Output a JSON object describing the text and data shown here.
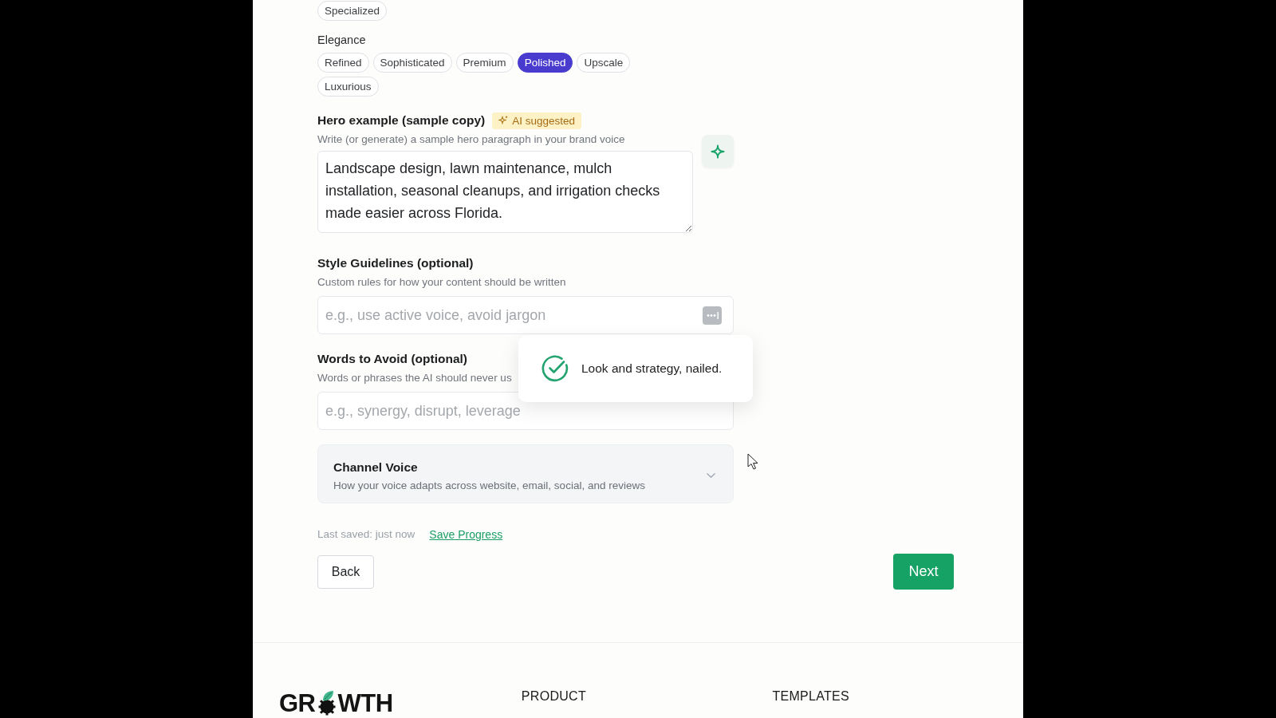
{
  "tag_groups": [
    {
      "tags": [
        {
          "label": "Specialized",
          "selected": false
        }
      ]
    },
    {
      "label": "Elegance",
      "tags": [
        {
          "label": "Refined",
          "selected": false
        },
        {
          "label": "Sophisticated",
          "selected": false
        },
        {
          "label": "Premium",
          "selected": false
        },
        {
          "label": "Polished",
          "selected": true
        },
        {
          "label": "Upscale",
          "selected": false
        },
        {
          "label": "Luxurious",
          "selected": false
        }
      ]
    }
  ],
  "hero_example": {
    "label": "Hero example (sample copy)",
    "badge": "AI suggested",
    "hint": "Write (or generate) a sample hero paragraph in your brand voice",
    "value": "Landscape design, lawn maintenance, mulch installation, seasonal cleanups, and irrigation checks made easier across Florida."
  },
  "style_guidelines": {
    "label": "Style Guidelines (optional)",
    "hint": "Custom rules for how your content should be written",
    "placeholder": "e.g., use active voice, avoid jargon"
  },
  "words_to_avoid": {
    "label": "Words to Avoid (optional)",
    "hint": "Words or phrases the AI should never us",
    "placeholder": "e.g., synergy, disrupt, leverage"
  },
  "channel_voice": {
    "title": "Channel Voice",
    "subtitle": "How your voice adapts across website, email, social, and reviews",
    "expanded": false
  },
  "save_status": {
    "text": "Last saved: just now",
    "link": "Save Progress"
  },
  "buttons": {
    "back": "Back",
    "next": "Next"
  },
  "toast": {
    "message": "Look and strategy, nailed."
  },
  "footer": {
    "logo_left": "GR",
    "logo_right": "WTH",
    "columns": [
      "PRODUCT",
      "TEMPLATES"
    ]
  }
}
